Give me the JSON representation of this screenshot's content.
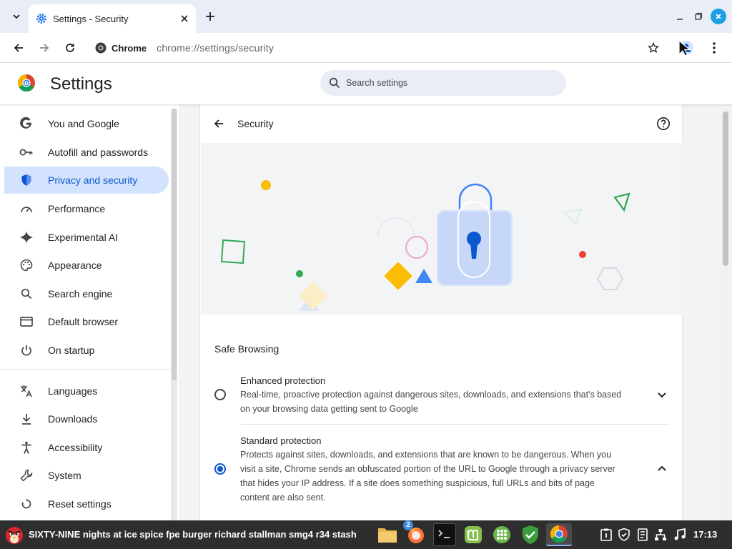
{
  "browser": {
    "tab_title": "Settings - Security",
    "site_chip": "Chrome",
    "url": "chrome://settings/security"
  },
  "settings": {
    "title": "Settings",
    "search_placeholder": "Search settings",
    "nav": [
      {
        "label": "You and Google",
        "icon": "google-g-icon",
        "active": false
      },
      {
        "label": "Autofill and passwords",
        "icon": "key-icon",
        "active": false
      },
      {
        "label": "Privacy and security",
        "icon": "shield-icon",
        "active": true
      },
      {
        "label": "Performance",
        "icon": "speedometer-icon",
        "active": false
      },
      {
        "label": "Experimental AI",
        "icon": "sparkle-icon",
        "active": false
      },
      {
        "label": "Appearance",
        "icon": "palette-icon",
        "active": false
      },
      {
        "label": "Search engine",
        "icon": "search-icon",
        "active": false
      },
      {
        "label": "Default browser",
        "icon": "browser-window-icon",
        "active": false
      },
      {
        "label": "On startup",
        "icon": "power-icon",
        "active": false
      },
      {
        "label": "Languages",
        "icon": "translate-icon",
        "active": false
      },
      {
        "label": "Downloads",
        "icon": "download-icon",
        "active": false
      },
      {
        "label": "Accessibility",
        "icon": "accessibility-icon",
        "active": false
      },
      {
        "label": "System",
        "icon": "wrench-icon",
        "active": false
      },
      {
        "label": "Reset settings",
        "icon": "reset-icon",
        "active": false
      }
    ]
  },
  "security": {
    "title": "Security",
    "section_title": "Safe Browsing",
    "options": [
      {
        "title": "Enhanced protection",
        "description": "Real-time, proactive protection against dangerous sites, downloads, and extensions that's based on your browsing data getting sent to Google",
        "selected": false,
        "expanded": false
      },
      {
        "title": "Standard protection",
        "description": "Protects against sites, downloads, and extensions that are known to be dangerous. When you visit a site, Chrome sends an obfuscated portion of the URL to Google through a privacy server that hides your IP address. If a site does something suspicious, full URLs and bits of page content are also sent.",
        "selected": true,
        "expanded": true
      }
    ]
  },
  "taskbar": {
    "window_title": "SIXTY-NINE nights at ice spice fpe burger richard stallman smg4 r34 stash",
    "firefox_badge": "2",
    "clock": "17:13"
  },
  "colors": {
    "accent": "#0b57d0",
    "nav_active_bg": "#d3e3fd",
    "taskbar_bg": "#2e2e2e"
  }
}
